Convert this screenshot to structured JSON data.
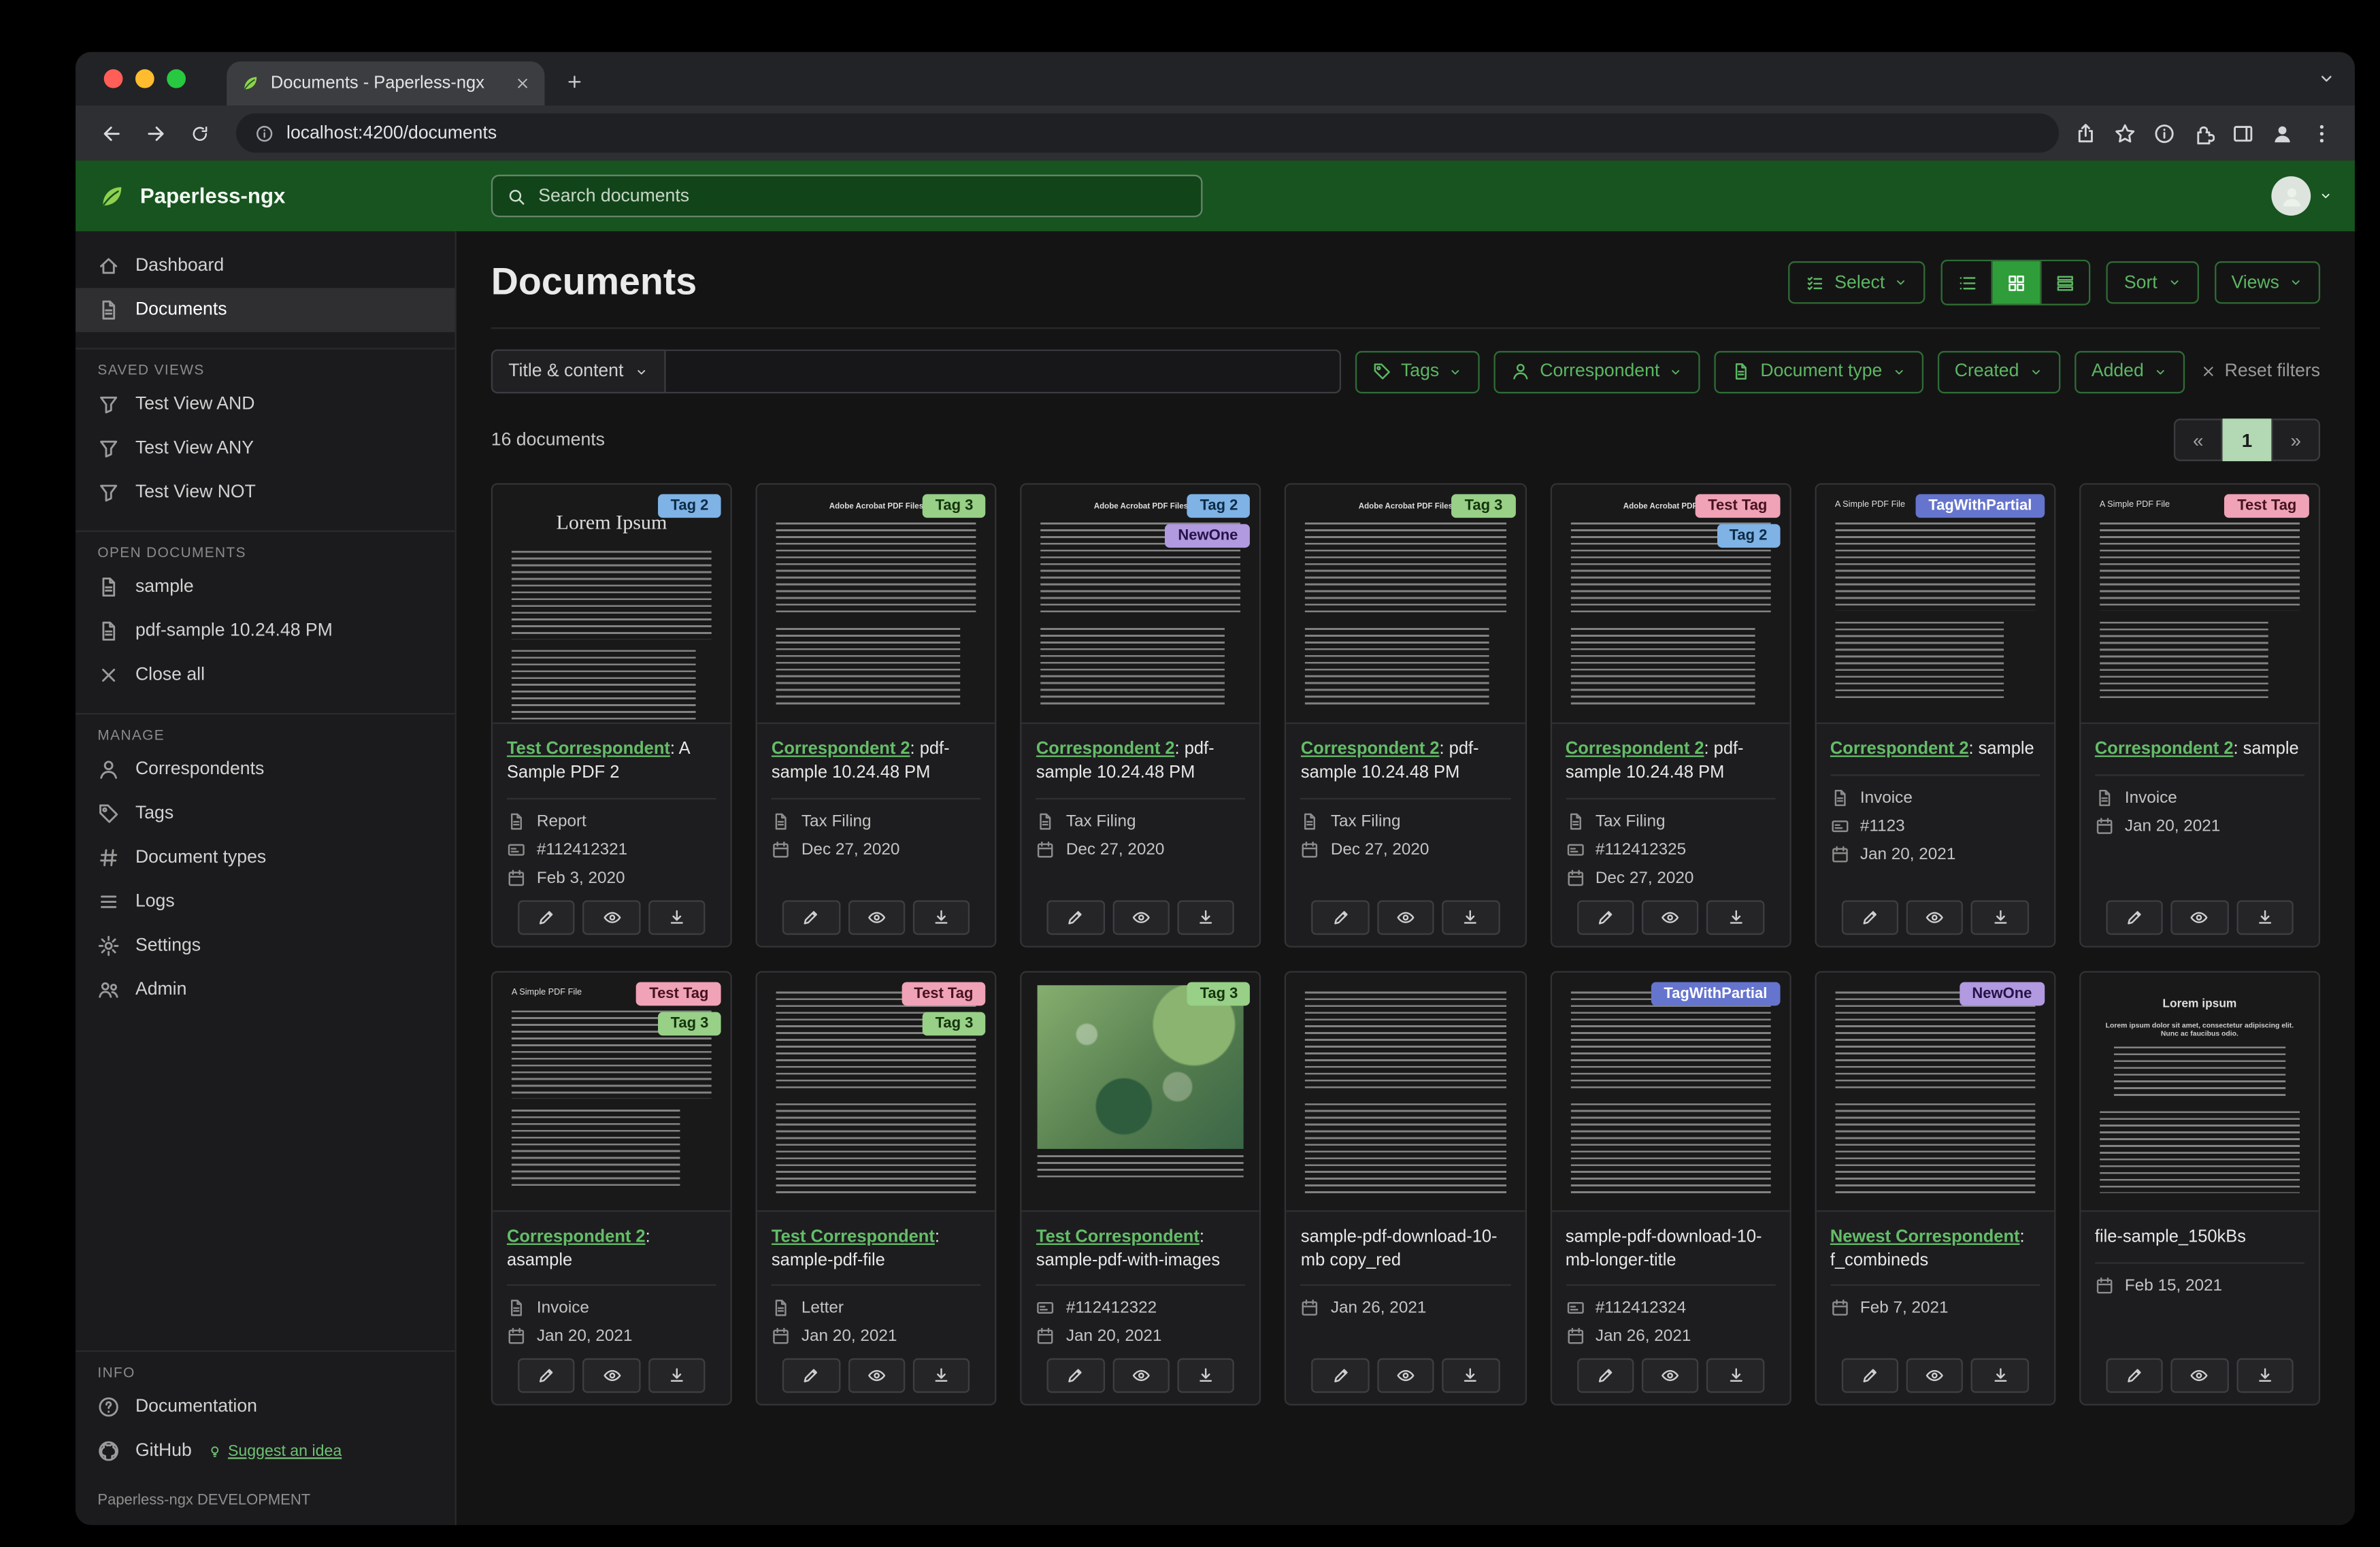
{
  "browser": {
    "tab_title": "Documents - Paperless-ngx",
    "url": "localhost:4200/documents"
  },
  "app_header": {
    "app_name": "Paperless-ngx",
    "search_placeholder": "Search documents"
  },
  "sidebar": {
    "dashboard": "Dashboard",
    "documents": "Documents",
    "saved_views_title": "SAVED VIEWS",
    "saved_views": [
      "Test View AND",
      "Test View ANY",
      "Test View NOT"
    ],
    "open_documents_title": "OPEN DOCUMENTS",
    "open_documents": [
      "sample",
      "pdf-sample 10.24.48 PM"
    ],
    "close_all": "Close all",
    "manage_title": "MANAGE",
    "manage": [
      "Correspondents",
      "Tags",
      "Document types",
      "Logs",
      "Settings",
      "Admin"
    ],
    "info_title": "INFO",
    "documentation": "Documentation",
    "github": "GitHub",
    "suggest": "Suggest an idea",
    "footer": "Paperless-ngx DEVELOPMENT"
  },
  "main": {
    "title": "Documents",
    "select_label": "Select",
    "sort_label": "Sort",
    "views_label": "Views",
    "count": "16 documents",
    "pagination": {
      "prev": "«",
      "page": "1",
      "next": "»"
    }
  },
  "filters": {
    "field": "Title & content",
    "tags": "Tags",
    "correspondent": "Correspondent",
    "document_type": "Document type",
    "created": "Created",
    "added": "Added",
    "reset": "Reset filters"
  },
  "colors": {
    "brand_green": "#17541f",
    "link_green": "#64bd68",
    "tag_tag2": "#7fb2e5",
    "tag_tag3": "#97d086",
    "tag_newone": "#b19ae0",
    "tag_testtag": "#f0a2b6",
    "tag_withpartial": "#6574cd"
  },
  "documents": [
    {
      "tags": [
        {
          "label": "Tag 2",
          "bg": "#7fb2e5",
          "fg": "#0d2b45"
        }
      ],
      "correspondent": "Test Correspondent",
      "title": ": A Sample PDF 2",
      "doc_type": "Report",
      "asn": "#112412321",
      "date": "Feb 3, 2020",
      "thumb": {
        "kind": "lorem",
        "heading": "Lorem Ipsum"
      }
    },
    {
      "tags": [
        {
          "label": "Tag 3",
          "bg": "#97d086",
          "fg": "#15330e"
        }
      ],
      "correspondent": "Correspondent 2",
      "title": ": pdf-sample 10.24.48 PM",
      "doc_type": "Tax Filing",
      "date": "Dec 27, 2020",
      "thumb": {
        "kind": "acrobat",
        "heading": "Adobe Acrobat PDF Files"
      }
    },
    {
      "tags": [
        {
          "label": "Tag 2",
          "bg": "#7fb2e5",
          "fg": "#0d2b45"
        },
        {
          "label": "NewOne",
          "bg": "#b19ae0",
          "fg": "#261447"
        }
      ],
      "correspondent": "Correspondent 2",
      "title": ": pdf-sample 10.24.48 PM",
      "doc_type": "Tax Filing",
      "date": "Dec 27, 2020",
      "thumb": {
        "kind": "acrobat",
        "heading": "Adobe Acrobat PDF Files"
      }
    },
    {
      "tags": [
        {
          "label": "Tag 3",
          "bg": "#97d086",
          "fg": "#15330e"
        }
      ],
      "correspondent": "Correspondent 2",
      "title": ": pdf-sample 10.24.48 PM",
      "doc_type": "Tax Filing",
      "date": "Dec 27, 2020",
      "thumb": {
        "kind": "acrobat",
        "heading": "Adobe Acrobat PDF Files"
      }
    },
    {
      "tags": [
        {
          "label": "Test Tag",
          "bg": "#f0a2b6",
          "fg": "#45131f"
        },
        {
          "label": "Tag 2",
          "bg": "#7fb2e5",
          "fg": "#0d2b45"
        }
      ],
      "correspondent": "Correspondent 2",
      "title": ": pdf-sample 10.24.48 PM",
      "doc_type": "Tax Filing",
      "asn": "#112412325",
      "date": "Dec 27, 2020",
      "thumb": {
        "kind": "acrobat",
        "heading": "Adobe Acrobat PDF Files"
      }
    },
    {
      "tags": [
        {
          "label": "TagWithPartial",
          "bg": "#6574cd",
          "fg": "#ffffff"
        }
      ],
      "correspondent": "Correspondent 2",
      "title": ": sample",
      "doc_type": "Invoice",
      "asn": "#1123",
      "date": "Jan 20, 2021",
      "thumb": {
        "kind": "simple",
        "heading": "A Simple PDF File"
      }
    },
    {
      "tags": [
        {
          "label": "Test Tag",
          "bg": "#f0a2b6",
          "fg": "#45131f"
        }
      ],
      "correspondent": "Correspondent 2",
      "title": ": sample",
      "doc_type": "Invoice",
      "date": "Jan 20, 2021",
      "thumb": {
        "kind": "simple",
        "heading": "A Simple PDF File"
      }
    },
    {
      "tags": [
        {
          "label": "Test Tag",
          "bg": "#f0a2b6",
          "fg": "#45131f"
        },
        {
          "label": "Tag 3",
          "bg": "#97d086",
          "fg": "#15330e"
        }
      ],
      "correspondent": "Correspondent 2",
      "title": ": asample",
      "doc_type": "Invoice",
      "date": "Jan 20, 2021",
      "thumb": {
        "kind": "simple",
        "heading": "A Simple PDF File"
      }
    },
    {
      "tags": [
        {
          "label": "Test Tag",
          "bg": "#f0a2b6",
          "fg": "#45131f"
        },
        {
          "label": "Tag 3",
          "bg": "#97d086",
          "fg": "#15330e"
        }
      ],
      "correspondent": "Test Correspondent",
      "title": ": sample-pdf-file",
      "doc_type": "Letter",
      "date": "Jan 20, 2021",
      "thumb": {
        "kind": "dense"
      }
    },
    {
      "tags": [
        {
          "label": "Tag 3",
          "bg": "#97d086",
          "fg": "#15330e"
        }
      ],
      "correspondent": "Test Correspondent",
      "title": ": sample-pdf-with-images",
      "asn": "#112412322",
      "date": "Jan 20, 2021",
      "thumb": {
        "kind": "map"
      }
    },
    {
      "tags": [],
      "title": "sample-pdf-download-10-mb copy_red",
      "date": "Jan 26, 2021",
      "thumb": {
        "kind": "dense"
      }
    },
    {
      "tags": [
        {
          "label": "TagWithPartial",
          "bg": "#6574cd",
          "fg": "#ffffff"
        }
      ],
      "title": "sample-pdf-download-10-mb-longer-title",
      "asn": "#112412324",
      "date": "Jan 26, 2021",
      "thumb": {
        "kind": "dense"
      }
    },
    {
      "tags": [
        {
          "label": "NewOne",
          "bg": "#b19ae0",
          "fg": "#261447"
        }
      ],
      "correspondent": "Newest Correspondent",
      "title": ": f_combineds",
      "date": "Feb 7, 2021",
      "thumb": {
        "kind": "dense"
      }
    },
    {
      "tags": [],
      "title": "file-sample_150kBs",
      "date": "Feb 15, 2021",
      "thumb": {
        "kind": "filesample",
        "heading": "Lorem ipsum",
        "subheading": "Lorem ipsum dolor sit amet, consectetur adipiscing elit. Nunc ac faucibus odio."
      }
    }
  ]
}
